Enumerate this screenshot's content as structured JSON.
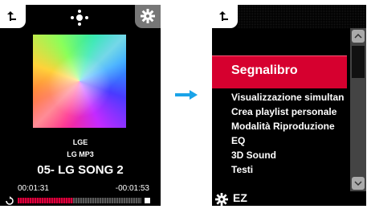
{
  "player": {
    "back_icon": "back-arrow-icon",
    "center_icon": "menu-dots-icon",
    "settings_icon": "gear-icon",
    "artist": "LGE",
    "album": "LG MP3",
    "song_title": "05- LG SONG 2",
    "elapsed": "00:01:31",
    "remaining": "-00:01:53",
    "progress": 0.45,
    "repeat_icon": "repeat-icon"
  },
  "transition_arrow_icon": "right-arrow-icon",
  "menu": {
    "back_icon": "back-arrow-icon",
    "selected": "Segnalibro",
    "items": [
      "Visualizzazione simultan",
      "Crea playlist personale",
      "Modalità Riproduzione",
      "EQ",
      "3D Sound",
      "Testi"
    ],
    "footer_label": "EZ",
    "footer_icon": "gear-icon"
  },
  "colors": {
    "accent": "#d6002f",
    "arrow": "#1aa3e8"
  }
}
